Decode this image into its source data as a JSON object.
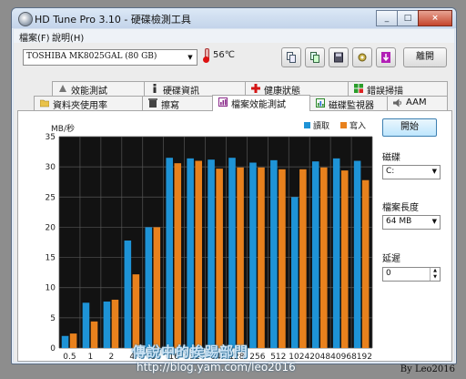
{
  "window": {
    "title": "HD Tune Pro 3.10 - 硬碟檢測工具",
    "controls": [
      "_",
      "□",
      "×"
    ]
  },
  "menu": {
    "items": [
      "檔案(F)",
      "說明(H)"
    ]
  },
  "toolbar": {
    "drive": "TOSHIBA MK8025GAL (80 GB)",
    "temperature": "56℃",
    "exit_label": "離開",
    "icons": [
      "copy-text-icon",
      "copy-screen-icon",
      "save-icon",
      "options-icon",
      "download-icon"
    ]
  },
  "tabs": {
    "row1": [
      {
        "label": "效能測試",
        "icon": "benchmark-icon"
      },
      {
        "label": "硬碟資訊",
        "icon": "info-icon"
      },
      {
        "label": "健康狀態",
        "icon": "health-icon"
      },
      {
        "label": "錯誤掃描",
        "icon": "error-scan-icon"
      }
    ],
    "row2": [
      {
        "label": "資料夾使用率",
        "icon": "folder-icon"
      },
      {
        "label": "擦寫",
        "icon": "erase-icon"
      },
      {
        "label": "檔案效能測試",
        "icon": "file-benchmark-icon",
        "active": true
      },
      {
        "label": "磁碟監視器",
        "icon": "monitor-icon"
      },
      {
        "label": "AAM",
        "icon": "speaker-icon"
      }
    ]
  },
  "side": {
    "start_label": "開始",
    "disk_label": "磁碟",
    "disk_value": "C:",
    "file_length_label": "檔案長度",
    "file_length_value": "64 MB",
    "delay_label": "延遲",
    "delay_value": "0"
  },
  "chart_data": {
    "type": "bar",
    "ylabel": "MB/秒",
    "ylim": [
      0,
      35
    ],
    "yticks": [
      0,
      5,
      10,
      15,
      20,
      25,
      30,
      35
    ],
    "grid": true,
    "legend_position": "top-right",
    "categories": [
      "0.5",
      "1",
      "2",
      "4",
      "8",
      "16",
      "32",
      "64",
      "128",
      "256",
      "512",
      "1024",
      "2048",
      "4096",
      "8192"
    ],
    "series": [
      {
        "name": "讀取",
        "color": "#1e93d6",
        "values": [
          2.0,
          7.5,
          7.7,
          17.8,
          20.0,
          31.5,
          31.4,
          31.2,
          31.5,
          30.7,
          31.1,
          25.0,
          30.9,
          31.4,
          31.0
        ]
      },
      {
        "name": "寫入",
        "color": "#e8811d",
        "values": [
          2.4,
          4.4,
          8.0,
          12.2,
          20.0,
          30.6,
          31.0,
          29.7,
          29.9,
          29.9,
          29.6,
          29.6,
          29.9,
          29.4,
          27.8
        ]
      }
    ]
  },
  "watermark": {
    "text": "傳說中的挨踢部門",
    "url": "http://blog.yam.com/leo2016",
    "byline": "By Leo2016"
  }
}
